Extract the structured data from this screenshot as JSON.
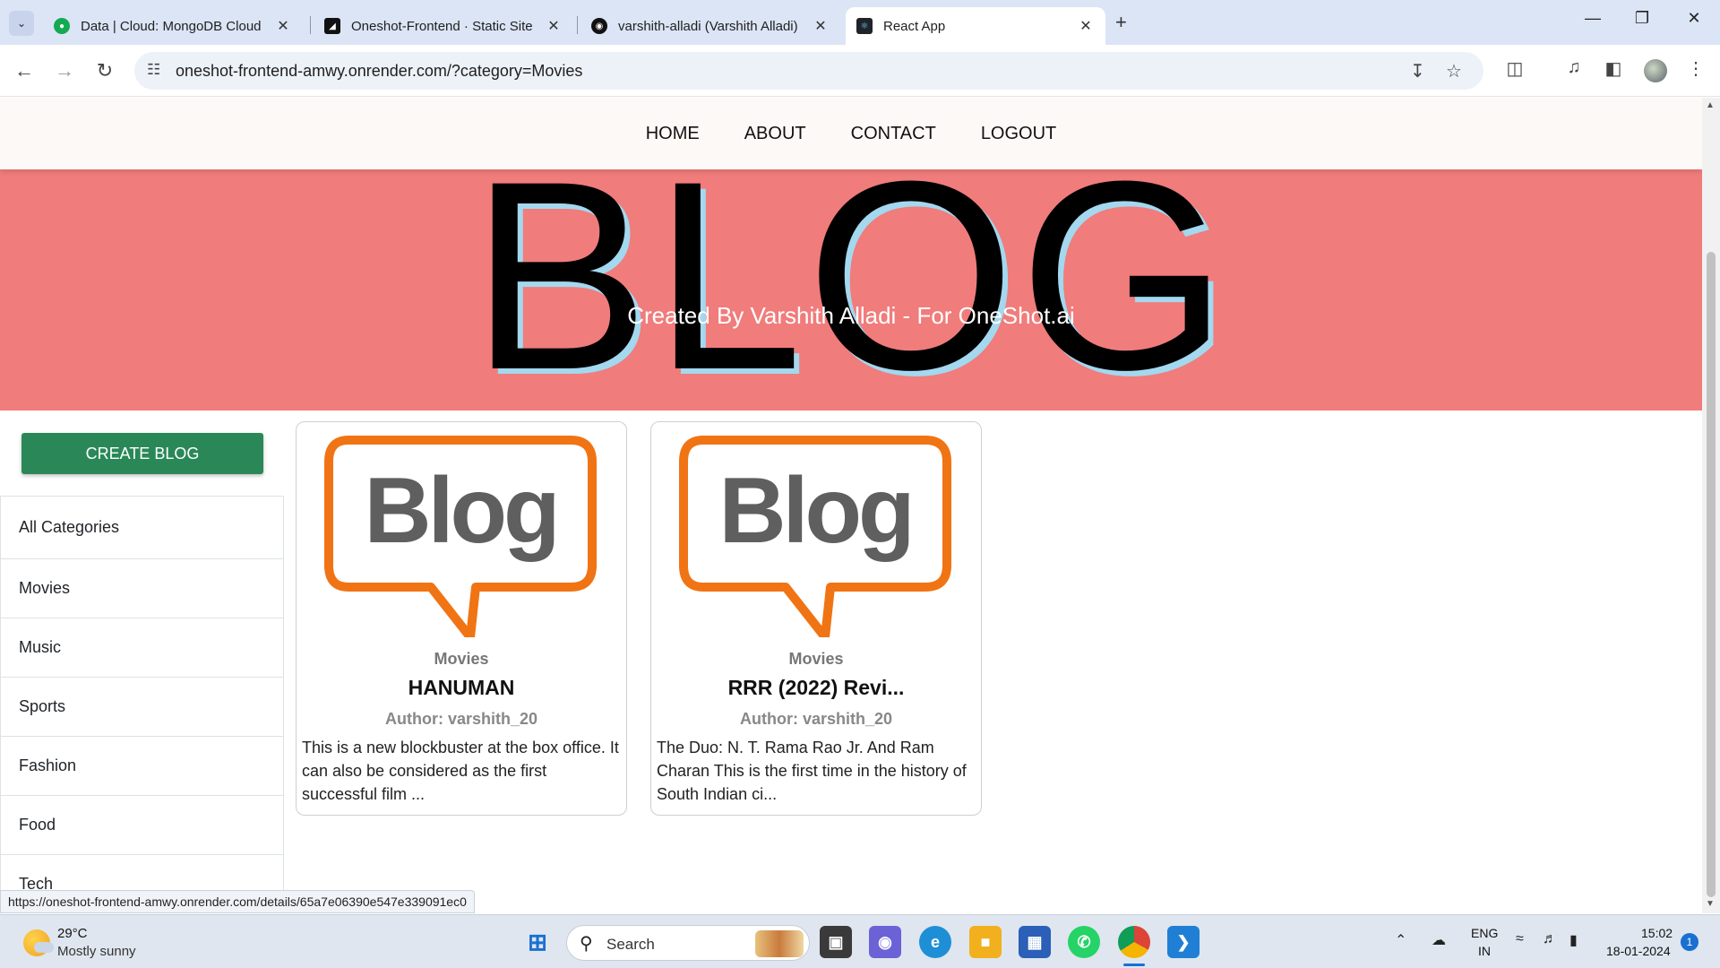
{
  "browser": {
    "tabs": [
      {
        "title": "Data | Cloud: MongoDB Cloud",
        "icon": "mongodb-leaf-icon",
        "color": "#13aa52"
      },
      {
        "title": "Oneshot-Frontend · Static Site",
        "icon": "render-icon",
        "color": "#111111"
      },
      {
        "title": "varshith-alladi (Varshith Alladi)",
        "icon": "github-icon",
        "color": "#111111"
      },
      {
        "title": "React App",
        "icon": "react-icon",
        "color": "#20232a"
      }
    ],
    "active_tab": 3,
    "url": "oneshot-frontend-amwy.onrender.com/?category=Movies",
    "status_url": "https://oneshot-frontend-amwy.onrender.com/details/65a7e06390e547e339091ec0"
  },
  "site": {
    "nav": [
      "HOME",
      "ABOUT",
      "CONTACT",
      "LOGOUT"
    ],
    "hero_title": "BLOG",
    "hero_subtitle": "Created By Varshith Alladi - For OneShot.ai",
    "create_button": "CREATE BLOG",
    "categories": [
      "All Categories",
      "Movies",
      "Music",
      "Sports",
      "Fashion",
      "Food",
      "Tech"
    ],
    "posts": [
      {
        "image_text": "Blog",
        "category": "Movies",
        "title": "HANUMAN",
        "author": "Author: varshith_20",
        "excerpt": "This is a new blockbuster at the box office. It can also be considered as the first successful film ..."
      },
      {
        "image_text": "Blog",
        "category": "Movies",
        "title": "RRR (2022) Revi...",
        "author": "Author: varshith_20",
        "excerpt": "The Duo: N. T. Rama Rao Jr. And Ram Charan This is the first time in the history of South Indian ci..."
      }
    ]
  },
  "colors": {
    "hero_bg": "#f07c7b",
    "hero_shadow": "#a3d8ef",
    "create_button": "#2a8858",
    "blog_logo_orange": "#f07414",
    "blog_logo_gray": "#5f5f5f"
  },
  "taskbar": {
    "temperature": "29°C",
    "weather": "Mostly sunny",
    "search": "Search",
    "lang_line1": "ENG",
    "lang_line2": "IN",
    "time": "15:02",
    "date": "18-01-2024",
    "notifications": "1"
  }
}
